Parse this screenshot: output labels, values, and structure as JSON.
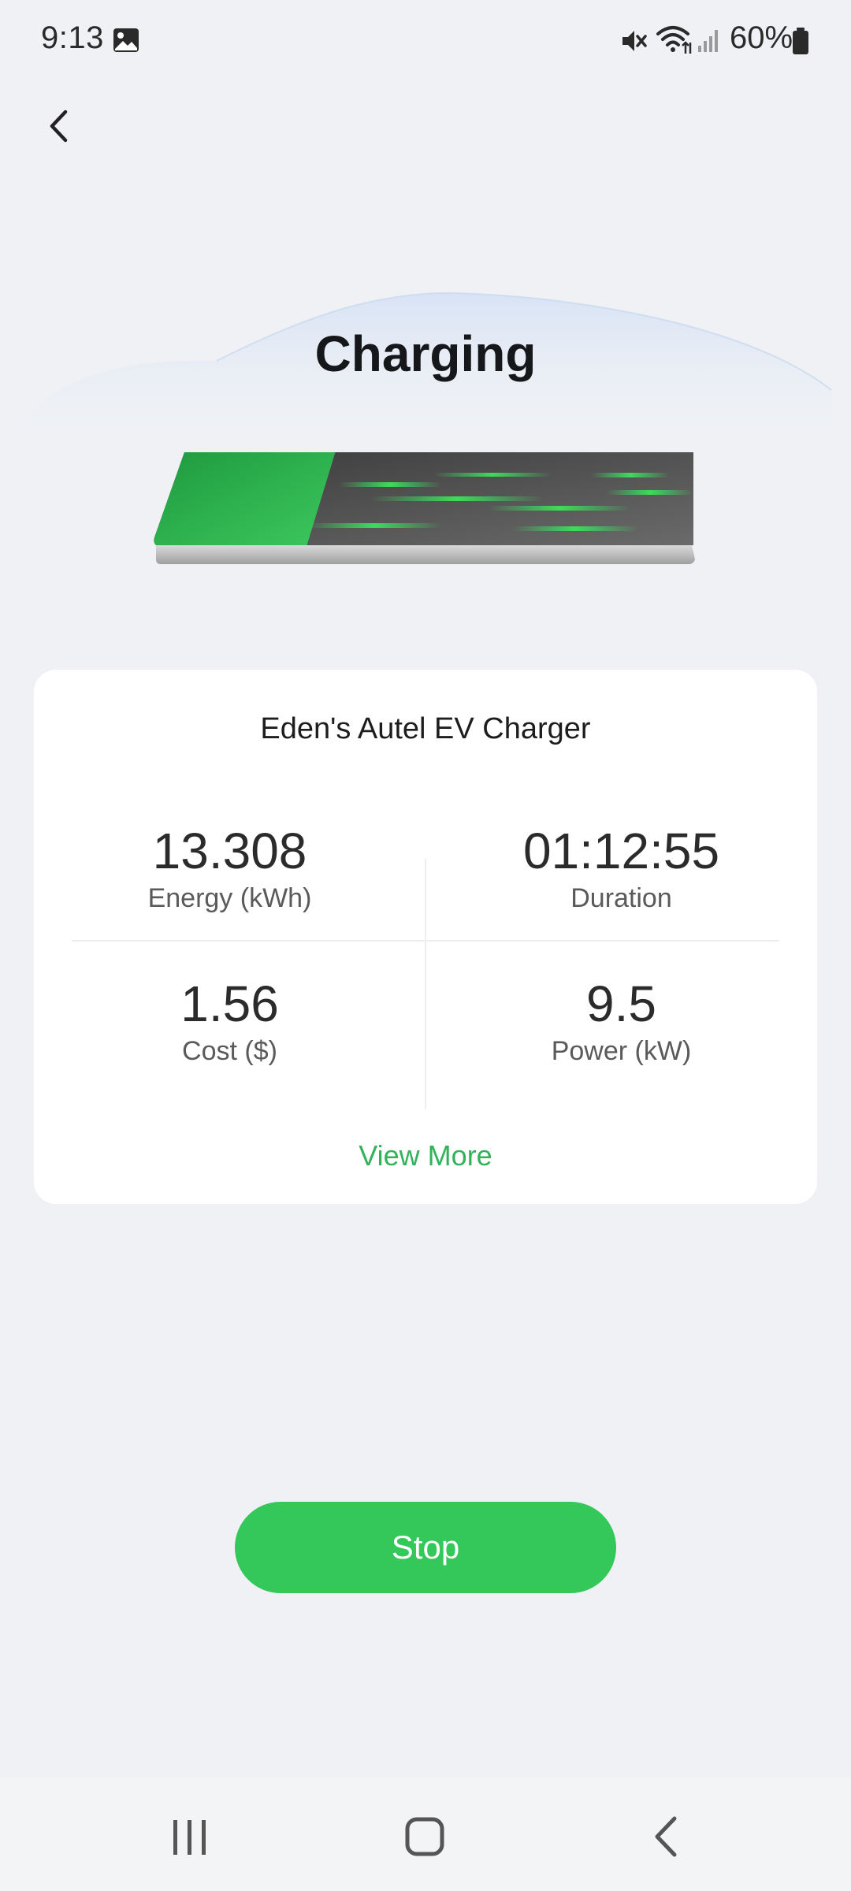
{
  "status_bar": {
    "time": "9:13",
    "battery_percent": "60%",
    "icons": [
      "gallery-icon",
      "mute-icon",
      "wifi-icon",
      "signal-icon",
      "battery-icon"
    ]
  },
  "header": {
    "back_icon": "chevron-left-icon",
    "title": "Charging"
  },
  "battery": {
    "charge_fraction": 0.28,
    "fill_color": "#2fb14d"
  },
  "card": {
    "charger_name": "Eden's Autel EV Charger",
    "stats": {
      "energy": {
        "value": "13.308",
        "label": "Energy (kWh)"
      },
      "duration": {
        "value": "01:12:55",
        "label": "Duration"
      },
      "cost": {
        "value": "1.56",
        "label": "Cost ($)"
      },
      "power": {
        "value": "9.5",
        "label": "Power (kW)"
      }
    },
    "view_more_label": "View More"
  },
  "actions": {
    "stop_label": "Stop"
  },
  "colors": {
    "accent": "#34c759",
    "link": "#32b25a",
    "background": "#eff1f5"
  },
  "nav_bar": {
    "icons": [
      "recents-icon",
      "home-icon",
      "back-icon"
    ]
  }
}
